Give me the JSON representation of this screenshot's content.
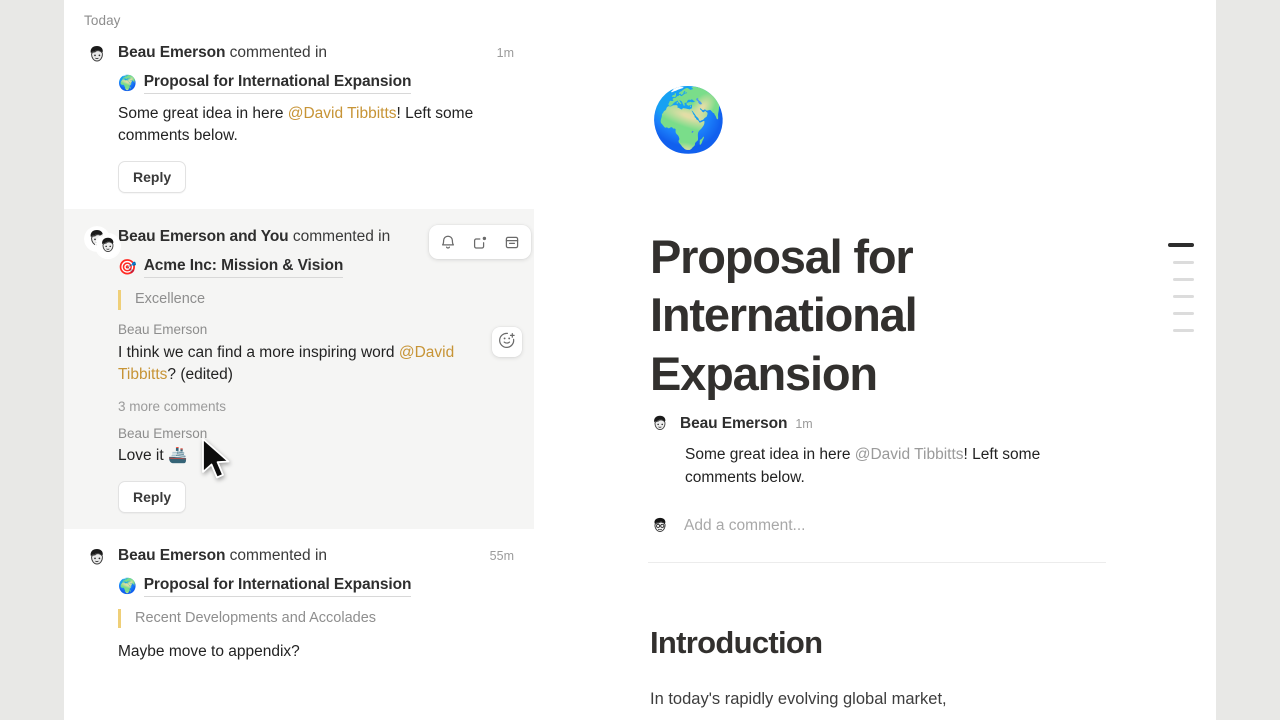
{
  "day_label": "Today",
  "notifications": [
    {
      "actor": "Beau Emerson",
      "verb": " commented in",
      "timestamp": "1m",
      "doc_emoji": "🌍",
      "doc_name": "Proposal for International Expansion",
      "body_prefix": "Some great idea in here ",
      "mention": "@David Tibbitts",
      "body_suffix": "! Left some comments below.",
      "reply_label": "Reply"
    },
    {
      "actor": "Beau Emerson and You",
      "verb": " commented in",
      "timestamp": "",
      "doc_emoji": "🎯",
      "doc_name": "Acme Inc: Mission & Vision",
      "quote": "Excellence",
      "sub_author": "Beau Emerson",
      "body_prefix": "I think we can find a more inspiring word ",
      "mention": "@David Tibbitts",
      "body_suffix": "? (edited)",
      "more_comments": "3 more comments",
      "sub_author_2": "Beau Emerson",
      "body_2": "Love it 🚢",
      "reply_label": "Reply",
      "actions": {
        "mute_label": "bell-icon",
        "unread_label": "mark-unread-icon",
        "archive_label": "archive-icon",
        "react_label": "add-reaction-icon"
      }
    },
    {
      "actor": "Beau Emerson",
      "verb": " commented in",
      "timestamp": "55m",
      "doc_emoji": "🌍",
      "doc_name": "Proposal for International Expansion",
      "quote": "Recent Developments and Accolades",
      "body_prefix": "Maybe move to appendix?"
    }
  ],
  "document": {
    "icon": "🌍",
    "title": "Proposal for International Expansion",
    "comment": {
      "author": "Beau Emerson",
      "timestamp": "1m",
      "body_prefix": "Some great idea in here ",
      "mention": "@David Tibbitts",
      "body_suffix": "! Left some comments below."
    },
    "add_comment_placeholder": "Add a comment...",
    "heading": "Introduction",
    "paragraph": "In today's rapidly evolving global market,"
  },
  "outline": {
    "active_index": 0,
    "items": [
      "section-1",
      "section-2",
      "section-3",
      "section-4",
      "section-5",
      "section-6"
    ]
  },
  "colors": {
    "mention": "#c79436",
    "quote_bar": "#efcf78",
    "selected_row": "#f5f5f4"
  }
}
